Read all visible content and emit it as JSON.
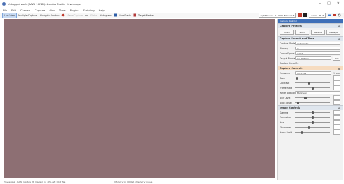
{
  "window": {
    "title": "Untagged work (RAW, 16/16) - Lumira Studio - LiveImage",
    "controls": {
      "minimize": "–",
      "maximize": "□",
      "close": "✕"
    }
  },
  "menu": [
    "File",
    "Edit",
    "Camera",
    "Capture",
    "View",
    "Tools",
    "Plugins",
    "Scripting",
    "Help"
  ],
  "toolbar": {
    "items": [
      {
        "label": "Live View",
        "active": true
      },
      {
        "label": "Multiple Capture",
        "active": false
      },
      {
        "label": "Navigate Capture",
        "active": false
      },
      {
        "label": "Save Capture",
        "dim": true
      },
      {
        "label": "Slider",
        "dim": true
      },
      {
        "label": "Histogram",
        "active": false
      },
      {
        "label": "Live Stack",
        "active": false
      },
      {
        "label": "Target Marker",
        "active": false
      }
    ],
    "selects": [
      {
        "value": "Light Source",
        "extra": "0 . 000",
        "unit": "Manual"
      },
      {
        "value": "Zoom",
        "extra": "Fit"
      }
    ],
    "swatches": [
      "#c0392b",
      "#1f1f1f",
      "#3a7bd5"
    ]
  },
  "panel": {
    "header": "Camera Control",
    "sections": [
      {
        "title": "Capture Profiles",
        "buttons": [
          "Load",
          "Save",
          "Save As",
          "Manage"
        ]
      },
      {
        "title": "Capture Format and Time",
        "rows": [
          {
            "label": "Capture Mode",
            "value": "Automatic"
          },
          {
            "label": "Binning",
            "value": "1"
          },
          {
            "label": "Colour Space",
            "value": "sRGB"
          },
          {
            "label": "Output Format",
            "value": "16-bit Raw",
            "button": "Add"
          },
          {
            "label": "Capture Duration",
            "value": "On"
          }
        ]
      },
      {
        "title": "Capture Controls",
        "highlight": true,
        "rows": [
          {
            "label": "Exposure",
            "value": "10.0 ms",
            "check": "Auto"
          },
          {
            "label": "Gain",
            "slider": 0.05
          },
          {
            "label": "Contrast",
            "slider": 0.4
          },
          {
            "label": "Frame Rate",
            "slider": 0.5
          },
          {
            "label": "White Balance",
            "value": "Balanced"
          },
          {
            "label": "Blur Level",
            "slider": 0.3
          },
          {
            "label": "Black Level",
            "slider": 0.1
          }
        ]
      },
      {
        "title": "Image Controls",
        "rows": [
          {
            "label": "Gamma",
            "slider": 0.5
          },
          {
            "label": "Saturation",
            "slider": 0.5
          },
          {
            "label": "Hue",
            "slider": 0.5
          },
          {
            "label": "Sharpness",
            "slider": 0.4
          },
          {
            "label": "Noise Limit",
            "slider": 0.2
          }
        ]
      }
    ]
  },
  "status": {
    "left": "Previewing - RAW Capture (8 Images) in 10% left 1011 fps",
    "right": "Memory in: 0.0 GB / Memory in use"
  },
  "colors": {
    "viewport": "#8d6f73",
    "accent": "#3e6fb8",
    "highlight_section": "#f6dcc0"
  }
}
